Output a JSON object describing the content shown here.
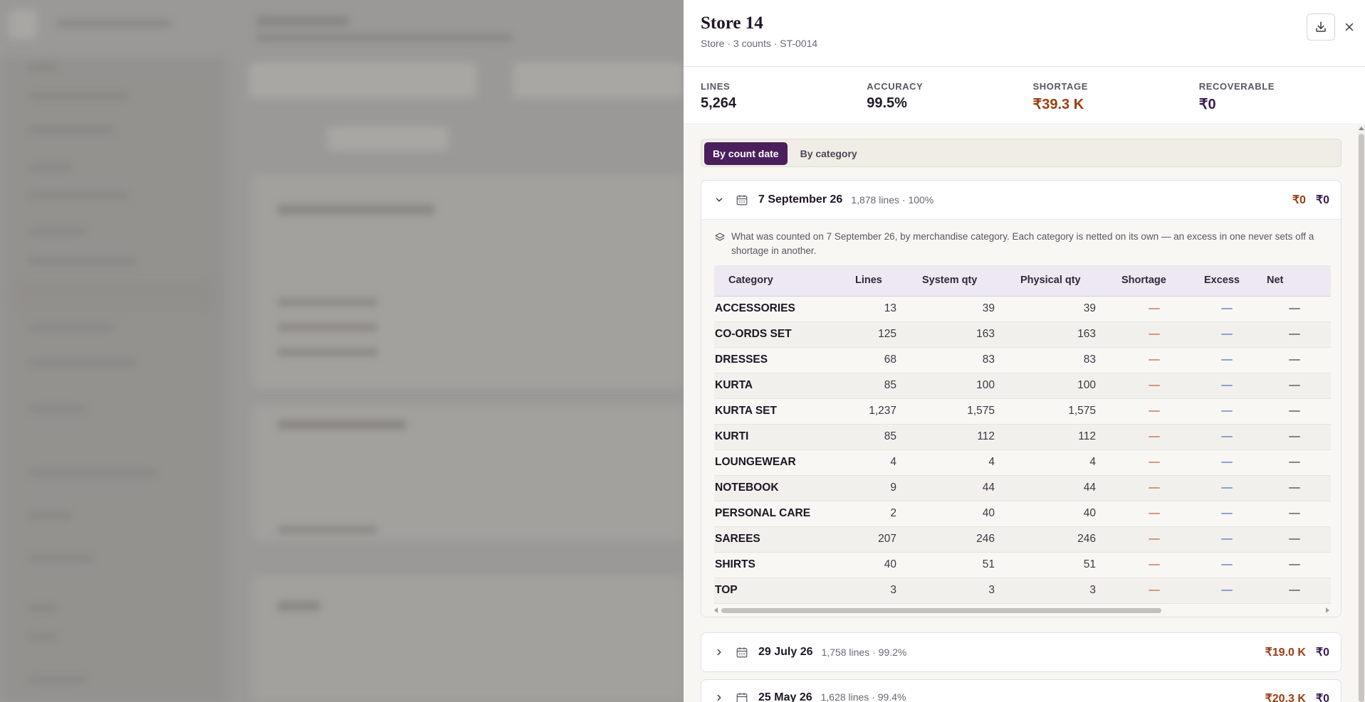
{
  "drawer": {
    "title": "Store 14",
    "subtitle_prefix": "Store · 3 counts · ",
    "store_code": "ST-0014",
    "download_icon": "download-icon",
    "close_icon": "close-icon"
  },
  "kpis": [
    {
      "label": "LINES",
      "value": "5,264"
    },
    {
      "label": "ACCURACY",
      "value": "99.5%"
    },
    {
      "label": "SHORTAGE",
      "value": "₹39.3 K"
    },
    {
      "label": "RECOVERABLE",
      "value": "₹0"
    }
  ],
  "colors": {
    "accent": "#4a1f5c",
    "shortage": "#9a3d12",
    "recoverable": "#3a1a55"
  },
  "tabs": {
    "by_count_date": "By count date",
    "by_category": "By category",
    "active": "by_count_date"
  },
  "counts": [
    {
      "date": "7 September 26",
      "meta": "1,878 lines · 100%",
      "shortage": "₹0",
      "recoverable": "₹0",
      "expanded": true,
      "note": "What was counted on 7 September 26, by merchandise category. Each category is netted on its own — an excess in one never sets off a shortage in another.",
      "columns": [
        "Category",
        "Lines",
        "System qty",
        "Physical qty",
        "Shortage",
        "Excess",
        "Net"
      ],
      "rows": [
        {
          "category": "ACCESSORIES",
          "lines": "13",
          "system": "39",
          "physical": "39",
          "shortage": "—",
          "excess": "—",
          "net": "—"
        },
        {
          "category": "CO-ORDS SET",
          "lines": "125",
          "system": "163",
          "physical": "163",
          "shortage": "—",
          "excess": "—",
          "net": "—"
        },
        {
          "category": "DRESSES",
          "lines": "68",
          "system": "83",
          "physical": "83",
          "shortage": "—",
          "excess": "—",
          "net": "—"
        },
        {
          "category": "KURTA",
          "lines": "85",
          "system": "100",
          "physical": "100",
          "shortage": "—",
          "excess": "—",
          "net": "—"
        },
        {
          "category": "KURTA SET",
          "lines": "1,237",
          "system": "1,575",
          "physical": "1,575",
          "shortage": "—",
          "excess": "—",
          "net": "—"
        },
        {
          "category": "KURTI",
          "lines": "85",
          "system": "112",
          "physical": "112",
          "shortage": "—",
          "excess": "—",
          "net": "—"
        },
        {
          "category": "LOUNGEWEAR",
          "lines": "4",
          "system": "4",
          "physical": "4",
          "shortage": "—",
          "excess": "—",
          "net": "—"
        },
        {
          "category": "NOTEBOOK",
          "lines": "9",
          "system": "44",
          "physical": "44",
          "shortage": "—",
          "excess": "—",
          "net": "—"
        },
        {
          "category": "PERSONAL CARE",
          "lines": "2",
          "system": "40",
          "physical": "40",
          "shortage": "—",
          "excess": "—",
          "net": "—"
        },
        {
          "category": "SAREES",
          "lines": "207",
          "system": "246",
          "physical": "246",
          "shortage": "—",
          "excess": "—",
          "net": "—"
        },
        {
          "category": "SHIRTS",
          "lines": "40",
          "system": "51",
          "physical": "51",
          "shortage": "—",
          "excess": "—",
          "net": "—"
        },
        {
          "category": "TOP",
          "lines": "3",
          "system": "3",
          "physical": "3",
          "shortage": "—",
          "excess": "—",
          "net": "—"
        }
      ]
    },
    {
      "date": "29 July 26",
      "meta": "1,758 lines · 99.2%",
      "shortage": "₹19.0 K",
      "recoverable": "₹0",
      "expanded": false
    },
    {
      "date": "25 May 26",
      "meta": "1,628 lines · 99.4%",
      "shortage": "₹20.3 K",
      "recoverable": "₹0",
      "expanded": false
    }
  ]
}
